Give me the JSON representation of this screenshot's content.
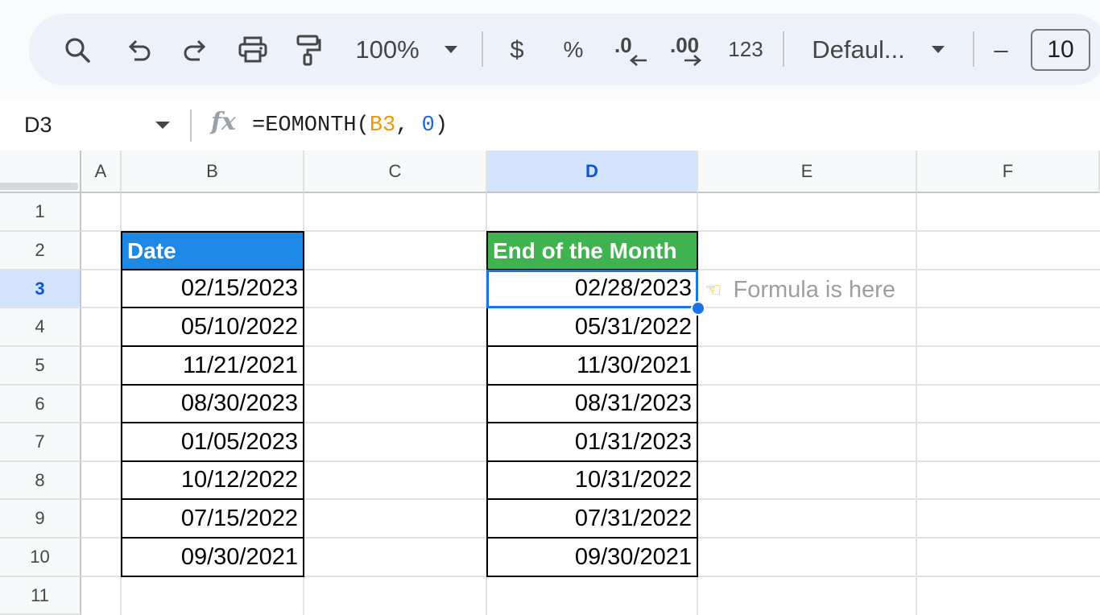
{
  "toolbar": {
    "zoom": "100%",
    "currency_label": "$",
    "percent_label": "%",
    "decrease_decimal_label": ".0",
    "increase_decimal_label": ".00",
    "number_format_label": "123",
    "font_name": "Defaul...",
    "font_size_decrease": "–",
    "font_size": "10",
    "icons": [
      "search-icon",
      "undo-icon",
      "redo-icon",
      "print-icon",
      "paint-format-icon",
      "caret-down-icon",
      "decrease-decimal-arrow-icon",
      "increase-decimal-arrow-icon"
    ]
  },
  "formula_bar": {
    "name_box": "D3",
    "fx_label": "fx",
    "formula_prefix": "=EOMONTH(",
    "formula_ref": "B3",
    "formula_sep": ", ",
    "formula_arg": "0",
    "formula_suffix": ")"
  },
  "columns": [
    "A",
    "B",
    "C",
    "D",
    "E",
    "F"
  ],
  "rows": [
    "1",
    "2",
    "3",
    "4",
    "5",
    "6",
    "7",
    "8",
    "9",
    "10",
    "11"
  ],
  "selected_column": "D",
  "selected_row": "3",
  "table_left": {
    "header": "Date",
    "values": [
      "02/15/2023",
      "05/10/2022",
      "11/21/2021",
      "08/30/2023",
      "01/05/2023",
      "10/12/2022",
      "07/15/2022",
      "09/30/2021"
    ]
  },
  "table_right": {
    "header": "End of the Month",
    "values": [
      "02/28/2023",
      "05/31/2022",
      "11/30/2021",
      "08/31/2023",
      "01/31/2023",
      "10/31/2022",
      "07/31/2022",
      "09/30/2021"
    ]
  },
  "note": {
    "icon": "pointing-hand-icon",
    "text": "Formula is here"
  },
  "colors": {
    "header_blue": "#1e88e5",
    "header_green": "#3fb34f",
    "selection": "#1a73e8",
    "formula_ref": "#f29900",
    "formula_number": "#1967d2"
  }
}
